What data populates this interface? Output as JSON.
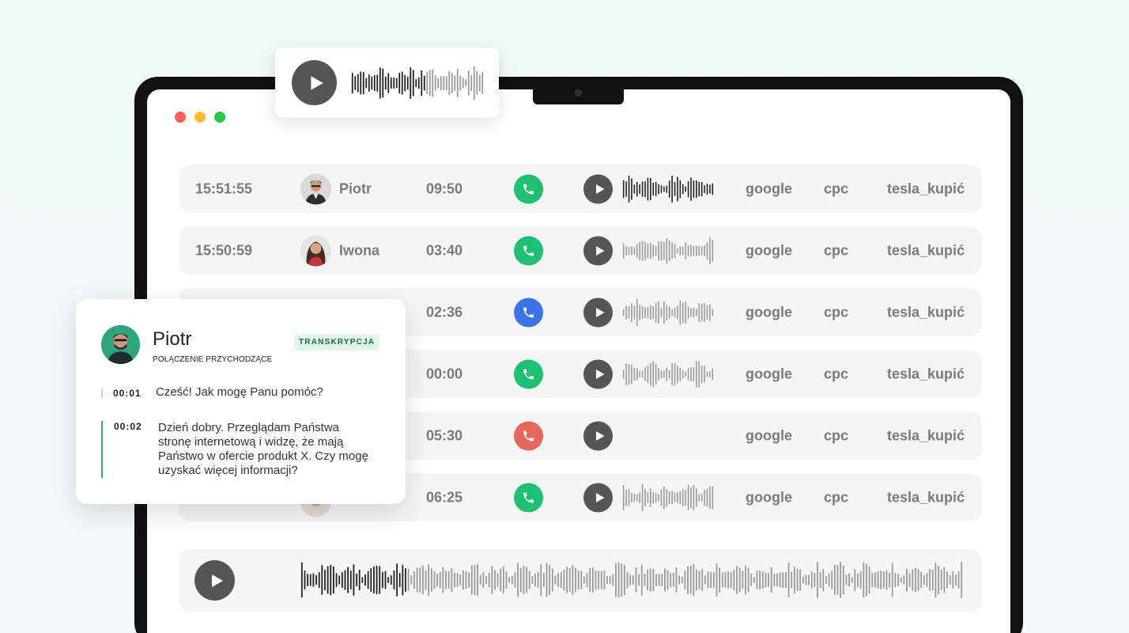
{
  "colors": {
    "status_green": "#1fbf74",
    "status_blue": "#3b74e8",
    "status_red": "#e8675c",
    "play_bg": "#555555",
    "row_bg": "#f5f5f5",
    "badge_bg": "#e0f6e8",
    "accent_bar": "#27b56a"
  },
  "rows": [
    {
      "time": "15:51:55",
      "name": "Piotr",
      "duration": "09:50",
      "status": "green",
      "has_wave": true,
      "source": "google",
      "medium": "cpc",
      "campaign": "tesla_kupić"
    },
    {
      "time": "15:50:59",
      "name": "Iwona",
      "duration": "03:40",
      "status": "green",
      "has_wave": true,
      "source": "google",
      "medium": "cpc",
      "campaign": "tesla_kupić"
    },
    {
      "time": "",
      "name": "",
      "duration": "02:36",
      "status": "blue",
      "has_wave": true,
      "source": "google",
      "medium": "cpc",
      "campaign": "tesla_kupić"
    },
    {
      "time": "",
      "name": "",
      "duration": "00:00",
      "status": "green",
      "has_wave": true,
      "source": "google",
      "medium": "cpc",
      "campaign": "tesla_kupić"
    },
    {
      "time": "",
      "name": "",
      "duration": "05:30",
      "status": "red",
      "has_wave": false,
      "source": "google",
      "medium": "cpc",
      "campaign": "tesla_kupić"
    },
    {
      "time": "",
      "name": "",
      "duration": "06:25",
      "status": "green",
      "has_wave": true,
      "source": "google",
      "medium": "cpc",
      "campaign": "tesla_kupić"
    }
  ],
  "transcript_card": {
    "name": "Piotr",
    "subtitle": "POŁĄCZENIE PRZYCHODZĄCE",
    "badge": "TRANSKRYPCJA",
    "messages": [
      {
        "time": "00:01",
        "text": "Cześć! Jak mogę Panu pomóc?"
      },
      {
        "time": "00:02",
        "text": "Dzień dobry. Przeglądam Państwa stronę internetową i widzę, że mają Państwo w ofercie produkt X. Czy mogę uzyskać więcej informacji?"
      }
    ]
  },
  "icons": {
    "play": "play-icon",
    "phone": "phone-icon",
    "waveform": "waveform-icon"
  }
}
